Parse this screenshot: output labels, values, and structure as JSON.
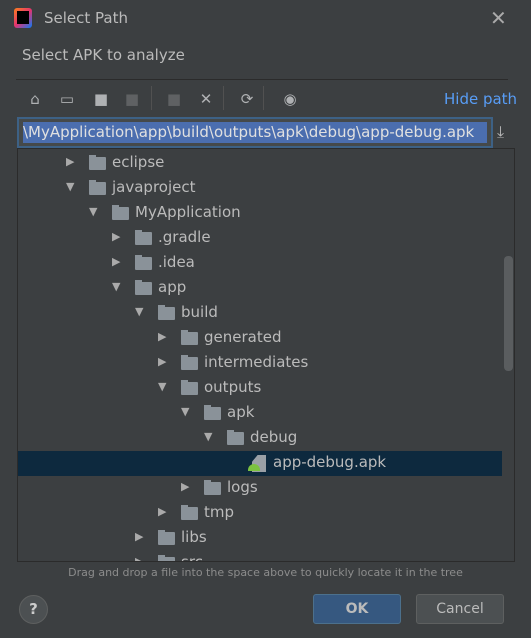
{
  "window": {
    "title": "Select Path",
    "subtitle": "Select APK to analyze"
  },
  "toolbar": {
    "icons": [
      "home-icon",
      "desktop-icon",
      "project-folder-icon",
      "module-folder-icon",
      "new-folder-icon",
      "delete-icon",
      "refresh-icon",
      "show-hidden-icon"
    ],
    "hide_path": "Hide path"
  },
  "path": {
    "value": "\\MyApplication\\app\\build\\outputs\\apk\\debug\\app-debug.apk"
  },
  "tree": {
    "items": [
      {
        "label": "eclipse",
        "level": 0,
        "expanded": false,
        "type": "folder"
      },
      {
        "label": "javaproject",
        "level": 0,
        "expanded": true,
        "type": "folder"
      },
      {
        "label": "MyApplication",
        "level": 1,
        "expanded": true,
        "type": "folder"
      },
      {
        "label": ".gradle",
        "level": 2,
        "expanded": false,
        "type": "folder"
      },
      {
        "label": ".idea",
        "level": 2,
        "expanded": false,
        "type": "folder"
      },
      {
        "label": "app",
        "level": 2,
        "expanded": true,
        "type": "folder"
      },
      {
        "label": "build",
        "level": 3,
        "expanded": true,
        "type": "folder"
      },
      {
        "label": "generated",
        "level": 4,
        "expanded": false,
        "type": "folder"
      },
      {
        "label": "intermediates",
        "level": 4,
        "expanded": false,
        "type": "folder"
      },
      {
        "label": "outputs",
        "level": 4,
        "expanded": true,
        "type": "folder"
      },
      {
        "label": "apk",
        "level": 5,
        "expanded": true,
        "type": "folder"
      },
      {
        "label": "debug",
        "level": 6,
        "expanded": true,
        "type": "folder"
      },
      {
        "label": "app-debug.apk",
        "level": 7,
        "type": "apk",
        "selected": true
      },
      {
        "label": "logs",
        "level": 5,
        "expanded": false,
        "type": "folder"
      },
      {
        "label": "tmp",
        "level": 4,
        "expanded": false,
        "type": "folder"
      },
      {
        "label": "libs",
        "level": 3,
        "expanded": false,
        "type": "folder"
      },
      {
        "label": "src",
        "level": 3,
        "expanded": false,
        "type": "folder"
      }
    ]
  },
  "hint": "Drag and drop a file into the space above to quickly locate it in the tree",
  "buttons": {
    "help": "?",
    "ok": "OK",
    "cancel": "Cancel"
  }
}
